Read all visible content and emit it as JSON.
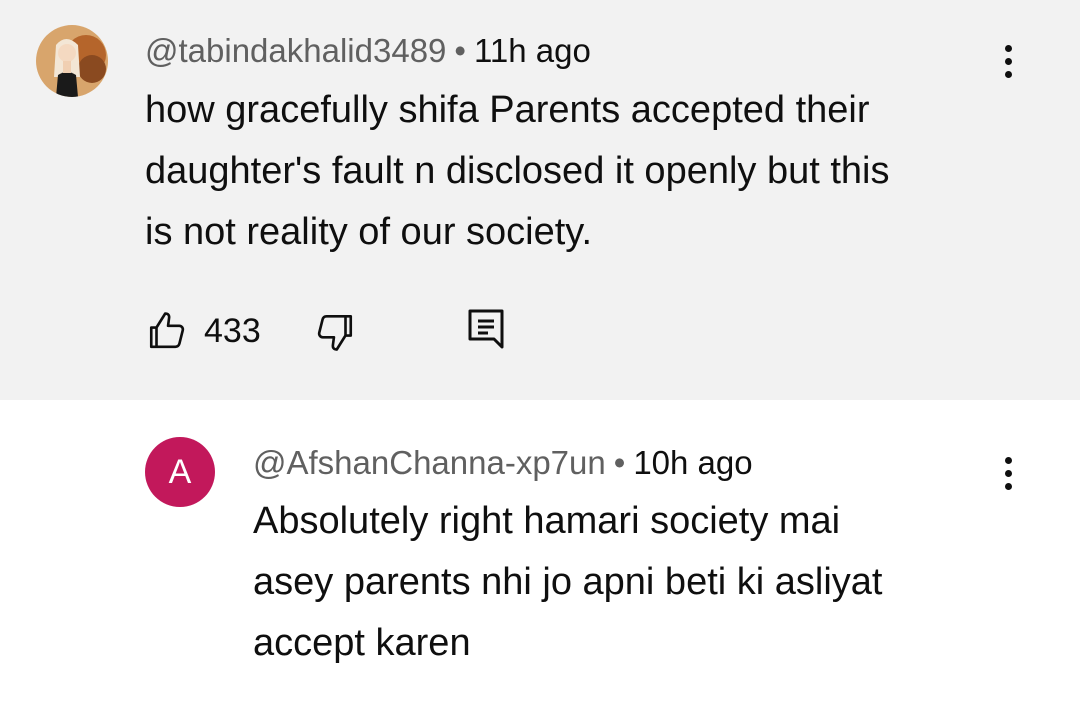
{
  "comments": [
    {
      "handle": "@tabindakhalid3489",
      "separator": "•",
      "time": "11h ago",
      "lines": [
        "how gracefully shifa Parents accepted their",
        "daughter's fault n disclosed it openly but this",
        "is not reality of our society."
      ],
      "likes": "433",
      "avatar_icon": "profile-photo"
    },
    {
      "handle": "@AfshanChanna-xp7un",
      "separator": "•",
      "time": "10h ago",
      "avatar_letter": "A",
      "lines": [
        "Absolutely right hamari society mai",
        "asey parents nhi jo apni beti ki asliyat",
        "accept karen"
      ]
    }
  ],
  "colors": {
    "highlight_bg": "#f2f2f2",
    "avatar_a": "#c2185b",
    "meta": "#606060"
  },
  "icons": [
    "more-vert-icon",
    "thumbs-up-icon",
    "thumbs-down-icon",
    "reply-comment-icon"
  ]
}
